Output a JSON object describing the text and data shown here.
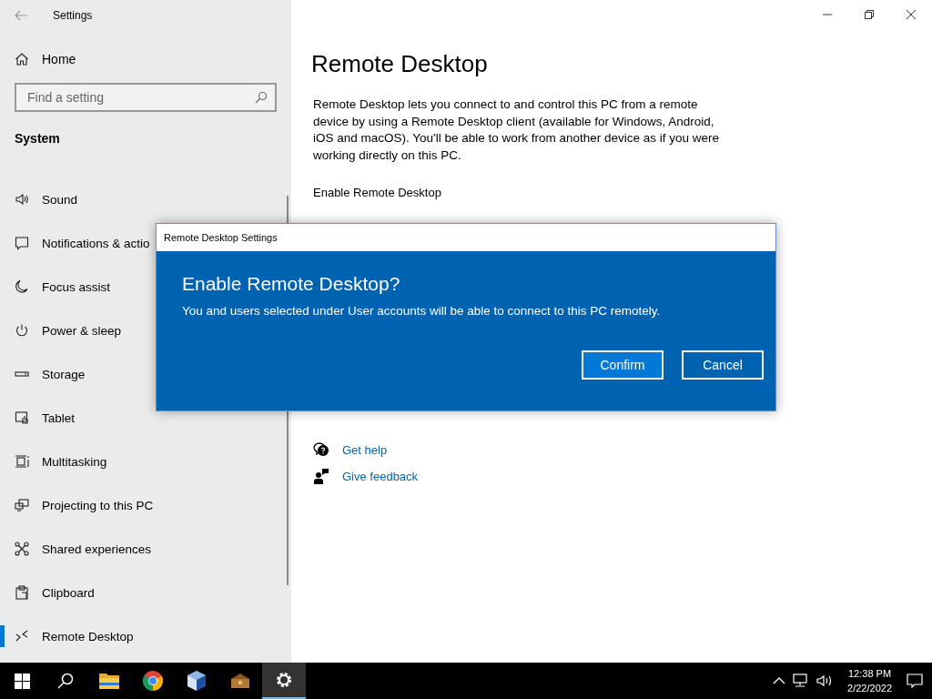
{
  "window": {
    "title": "Settings"
  },
  "sidebar": {
    "home": "Home",
    "search": {
      "placeholder": "Find a setting"
    },
    "section": "System",
    "items": [
      {
        "label": "Sound",
        "kind": "sound",
        "selected": false
      },
      {
        "label": "Notifications & actio",
        "kind": "notifications",
        "selected": false
      },
      {
        "label": "Focus assist",
        "kind": "focus",
        "selected": false
      },
      {
        "label": "Power & sleep",
        "kind": "power",
        "selected": false
      },
      {
        "label": "Storage",
        "kind": "storage",
        "selected": false
      },
      {
        "label": "Tablet",
        "kind": "tablet",
        "selected": false
      },
      {
        "label": "Multitasking",
        "kind": "multitasking",
        "selected": false
      },
      {
        "label": "Projecting to this PC",
        "kind": "projecting",
        "selected": false
      },
      {
        "label": "Shared experiences",
        "kind": "shared",
        "selected": false
      },
      {
        "label": "Clipboard",
        "kind": "clipboard",
        "selected": false
      },
      {
        "label": "Remote Desktop",
        "kind": "remote",
        "selected": true
      }
    ]
  },
  "main": {
    "title": "Remote Desktop",
    "description": "Remote Desktop lets you connect to and control this PC from a remote device by using a Remote Desktop client (available for Windows, Android, iOS and macOS). You'll be able to work from another device as if you were working directly on this PC.",
    "setting_label": "Enable Remote Desktop",
    "links": [
      {
        "label": "Get help",
        "kind": "help"
      },
      {
        "label": "Give feedback",
        "kind": "feedback"
      }
    ]
  },
  "dialog": {
    "title": "Remote Desktop Settings",
    "heading": "Enable Remote Desktop?",
    "message": "You and users selected under User accounts will be able to connect to this PC remotely.",
    "buttons": [
      "Confirm",
      "Cancel"
    ]
  },
  "taskbar": {
    "apps": [
      {
        "kind": "explorer",
        "selected": false
      },
      {
        "kind": "chrome",
        "selected": false
      },
      {
        "kind": "virtualbox",
        "selected": false
      },
      {
        "kind": "chest",
        "selected": false
      },
      {
        "kind": "settings",
        "selected": true
      }
    ],
    "time": "12:38 PM",
    "date": "2/22/2022"
  }
}
